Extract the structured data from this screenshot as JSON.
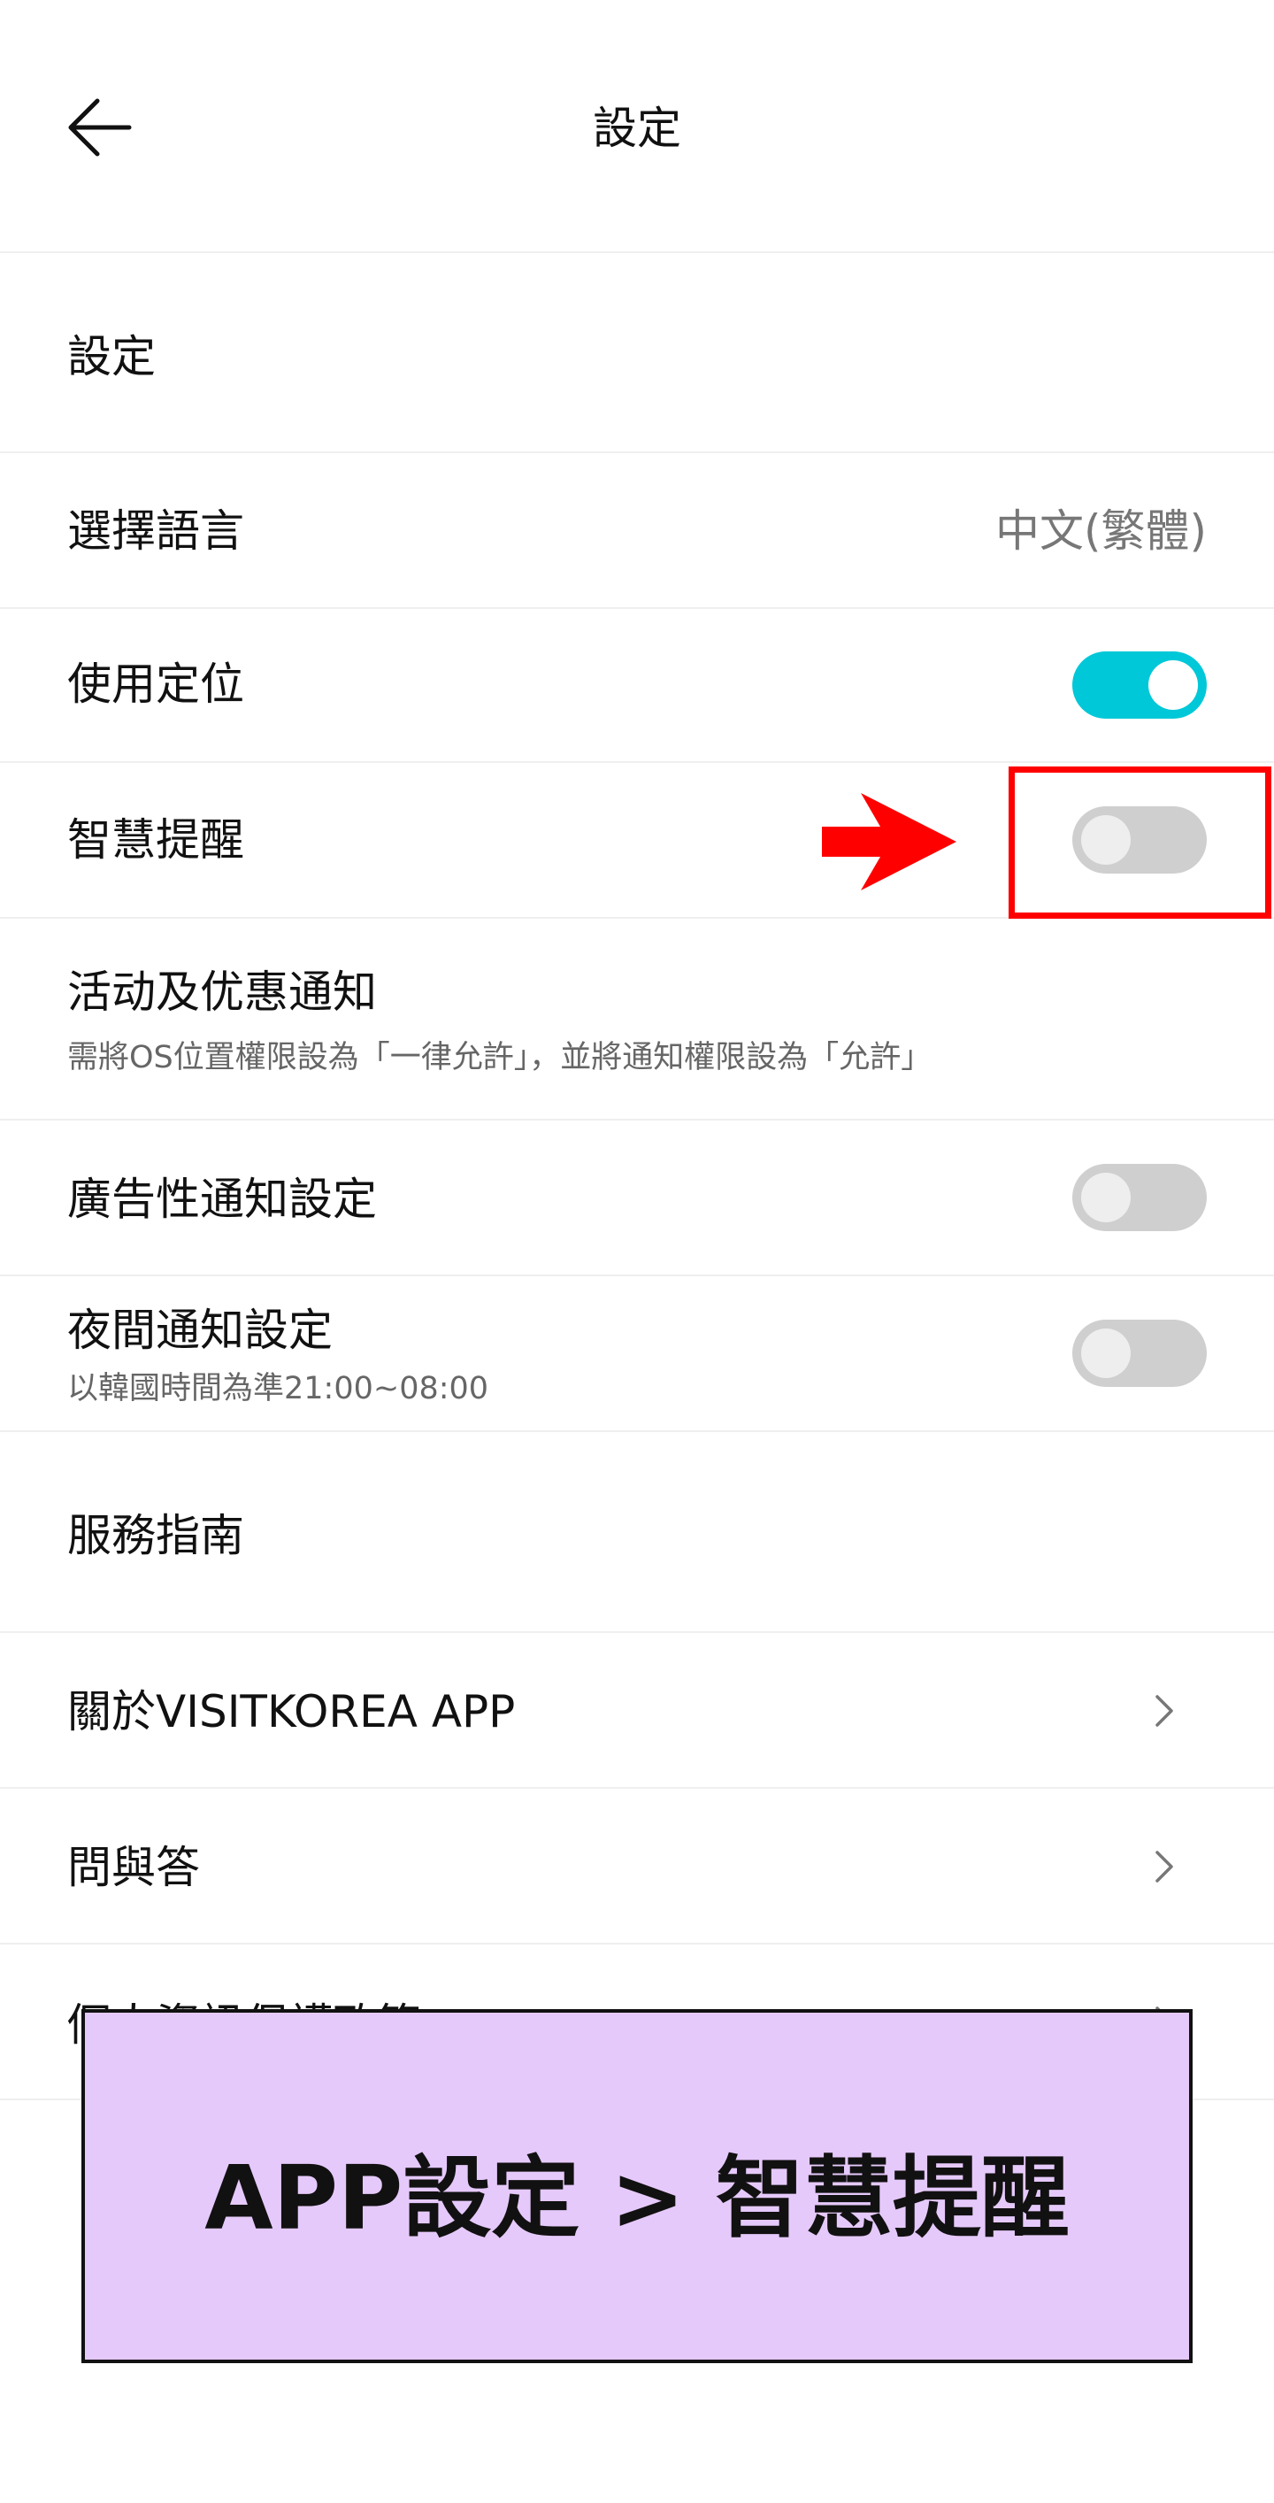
{
  "header": {
    "title": "設定",
    "back_icon": "arrow-left-icon"
  },
  "section_settings": {
    "title": "設定"
  },
  "language": {
    "label": "選擇語言",
    "value": "中文(繁體)"
  },
  "location": {
    "label": "使用定位",
    "enabled": true
  },
  "smart_reminder": {
    "label": "智慧提醒",
    "enabled": false
  },
  "promo_notice": {
    "label": "活动及优惠通知",
    "description": "需將OS位置權限設為「一律允許」，並將通知權限設為「允許」"
  },
  "ad_notice": {
    "label": "廣告性通知設定",
    "enabled": false
  },
  "night_notice": {
    "label": "夜間通知設定",
    "description": "以韓國時間為準21:00~08:00",
    "enabled": false
  },
  "section_service": {
    "title": "服務指南"
  },
  "about": {
    "label": "關於VISITKOREA APP"
  },
  "faq": {
    "label": "問與答"
  },
  "privacy": {
    "label": "個人資訊保護政策"
  },
  "caption": {
    "text": "APP設定 > 智慧提醒"
  },
  "colors": {
    "accent": "#00c8d8",
    "toggle_off": "#cfcfcf",
    "highlight": "#ff0000",
    "caption_bg": "#e6c9fb"
  }
}
